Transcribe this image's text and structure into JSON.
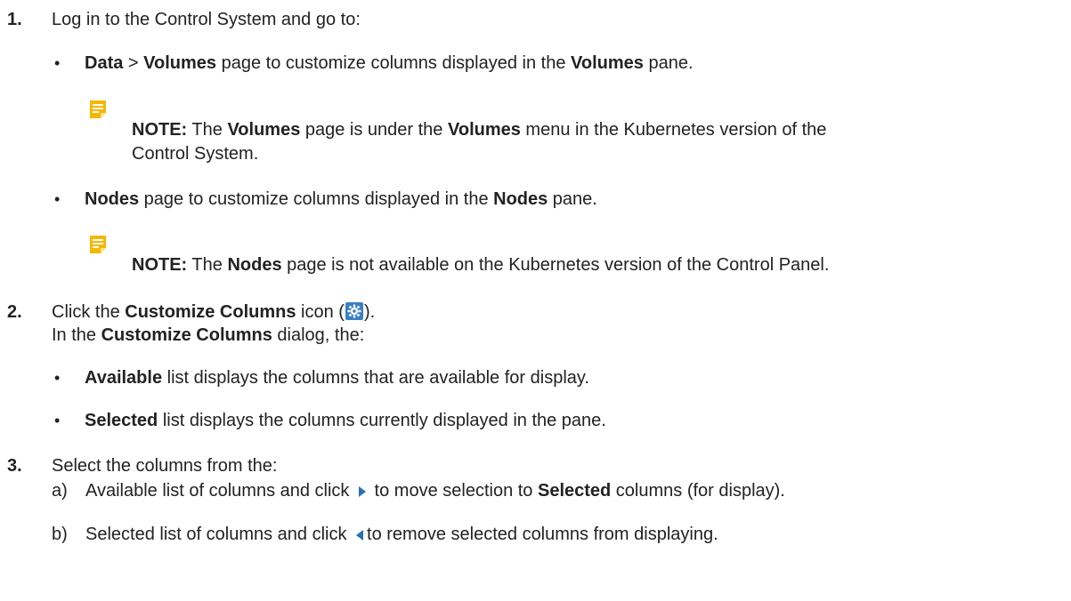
{
  "step1": {
    "number": "1.",
    "text": "Log in to the Control System and go to:",
    "bullet_data": {
      "bold1": "Data",
      "sep": " > ",
      "bold2": "Volumes",
      "mid": " page to customize columns displayed in the ",
      "bold3": "Volumes",
      "end": " pane."
    },
    "note1": {
      "icon": "note-icon",
      "label": "NOTE:",
      "t1": " The ",
      "b1": "Volumes",
      "t2": " page is under the ",
      "b2": "Volumes",
      "t3": " menu in the Kubernetes version of the",
      "line2": "Control System."
    },
    "bullet_nodes": {
      "bold1": "Nodes",
      "mid": " page to customize columns displayed in the ",
      "bold2": "Nodes",
      "end": " pane."
    },
    "note2": {
      "icon": "note-icon",
      "label": "NOTE:",
      "t1": " The ",
      "b1": "Nodes",
      "t2": " page is not available on the Kubernetes version of the Control Panel."
    }
  },
  "step2": {
    "number": "2.",
    "t1": "Click the ",
    "b1": "Customize Columns",
    "t2": " icon (",
    "t3": ").",
    "icon": "gear-icon",
    "line2_t1": "In the ",
    "line2_b1": "Customize Columns",
    "line2_t2": " dialog, the:",
    "bullet_available": {
      "bold": "Available",
      "rest": " list displays the columns that are available for display."
    },
    "bullet_selected": {
      "bold": "Selected",
      "rest": " list displays the columns currently displayed in the pane."
    }
  },
  "step3": {
    "number": "3.",
    "text": "Select the columns from the:",
    "a": {
      "label": "a)",
      "t1": "Available list of columns and click ",
      "icon": "right-arrow-icon",
      "t2": " to move selection to ",
      "b1": "Selected",
      "t3": " columns (for display)."
    },
    "b": {
      "label": "b)",
      "t1": "Selected list of columns and click ",
      "icon": "left-arrow-icon",
      "t2": "to remove selected columns from displaying."
    }
  },
  "colors": {
    "text": "#222222",
    "note_icon": "#f5b700",
    "gear_bg": "#3a7fc4",
    "arrow": "#2b6fb6"
  }
}
